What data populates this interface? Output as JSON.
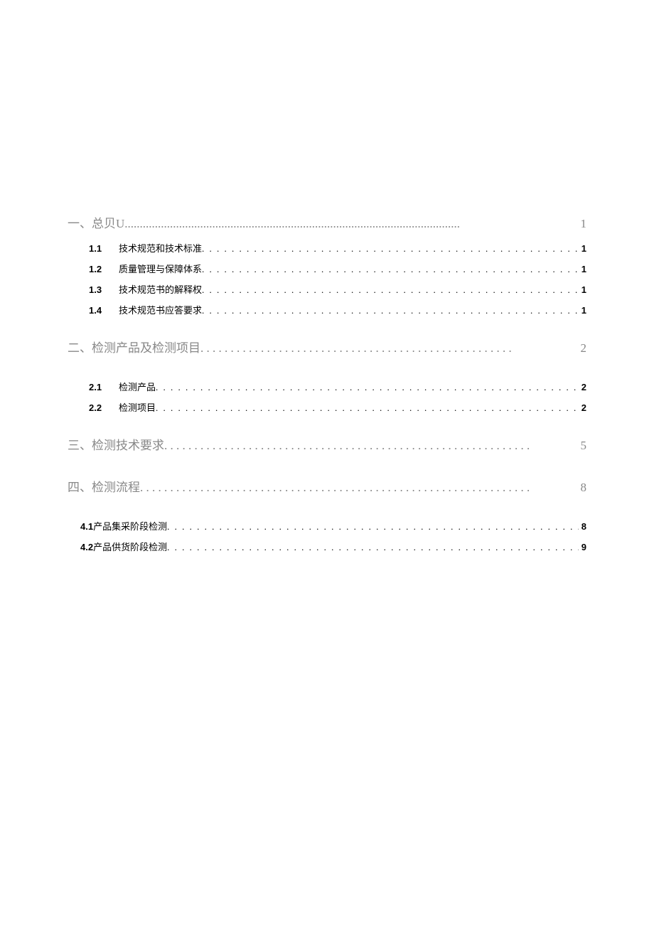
{
  "toc": [
    {
      "level": "level-1",
      "num": "",
      "title": "一、总贝U",
      "page": "1",
      "dots": "..............................................................................................................."
    },
    {
      "level": "level-2",
      "num": "1.1",
      "title": "技术规范和技术标准",
      "page": "1",
      "dots": " . . . . . . . . . . . . . . . . . . . . . . . . . . . . . . . . . . . . . . . . . . . . . . . . . . . . . . . . . . . . . . . . . . . . . . . . "
    },
    {
      "level": "level-2",
      "num": "1.2",
      "title": "质量管理与保障体系",
      "page": "1",
      "dots": " . . . . . . . . . . . . . . . . . . . . . . . . . . . . . . . . . . . . . . . . . . . . . . . . . . . . . . . . . . . . . . . . . . . . . . . . "
    },
    {
      "level": "level-2",
      "num": "1.3",
      "title": "技术规范书的解释权",
      "page": "1",
      "dots": " . . . . . . . . . . . . . . . . . . . . . . . . . . . . . . . . . . . . . . . . . . . . . . . . . . . . . . . . . . . . . . . . . . . . . . . . "
    },
    {
      "level": "level-2",
      "num": "1.4",
      "title": "技术规范书应答要求",
      "page": "1",
      "dots": " . . . . . . . . . . . . . . . . . . . . . . . . . . . . . . . . . . . . . . . . . . . . . . . . . . . . . . . . . . . . . . . . . . . . . . . . "
    },
    {
      "level": "spacer"
    },
    {
      "level": "level-1",
      "num": "",
      "title": "二、检测产品及检测项目",
      "page": "2",
      "dots": ". . . . . . . . . . . . . . . . . . . . . . . . . . . . . . . . . . . . . . . . . . . . . . . . . . . . "
    },
    {
      "level": "spacer"
    },
    {
      "level": "level-2",
      "num": "2.1",
      "title": "检测产品",
      "page": "2",
      "dots": " . . . . . . . . . . . . . . . . . . . . . . . . . . . . . . . . . . . . . . . . . . . . . . . . . . . . . . . . . . . . . . . . . . . . . . . . . . . . . . . . "
    },
    {
      "level": "level-2",
      "num": "2.2",
      "title": "检测项目",
      "page": "2",
      "dots": " . . . . . . . . . . . . . . . . . . . . . . . . . . . . . . . . . . . . . . . . . . . . . . . . . . . . . . . . . . . . . . . . . . . . . . . . . . . . . . . . "
    },
    {
      "level": "spacer"
    },
    {
      "level": "level-1",
      "num": "",
      "title": "三、检测技术要求",
      "page": "5",
      "dots": ". . . . . . . . . . . . . . . . . . . . . . . . . . . . . . . . . . . . . . . . . . . . . . . . . . . . . . . . . . . . . "
    },
    {
      "level": "spacer"
    },
    {
      "level": "level-1",
      "num": "",
      "title": "四、检测流程",
      "page": "8",
      "dots": ". . . . . . . . . . . . . . . . . . . . . . . . . . . . . . . . . . . . . . . . . . . . . . . . . . . . . . . . . . . . . . . . . "
    },
    {
      "level": "spacer"
    },
    {
      "level": "level-2b",
      "num": "4.1",
      "title": " 产品集采阶段检测",
      "page": "8",
      "dots": " . . . . . . . . . . . . . . . . . . . . . . . . . . . . . . . . . . . . . . . . . . . . . . . . . . . . . . . . . . . . . . . . . . . . . . . . . . . . "
    },
    {
      "level": "level-2b",
      "num": "4.2",
      "title": " 产品供货阶段检测",
      "page": "9",
      "dots": " . . . . . . . . . . . . . . . . . . . . . . . . . . . . . . . . . . . . . . . . . . . . . . . . . . . . . . . . . . . . . . . . . . . . . . . . . . . . "
    }
  ]
}
